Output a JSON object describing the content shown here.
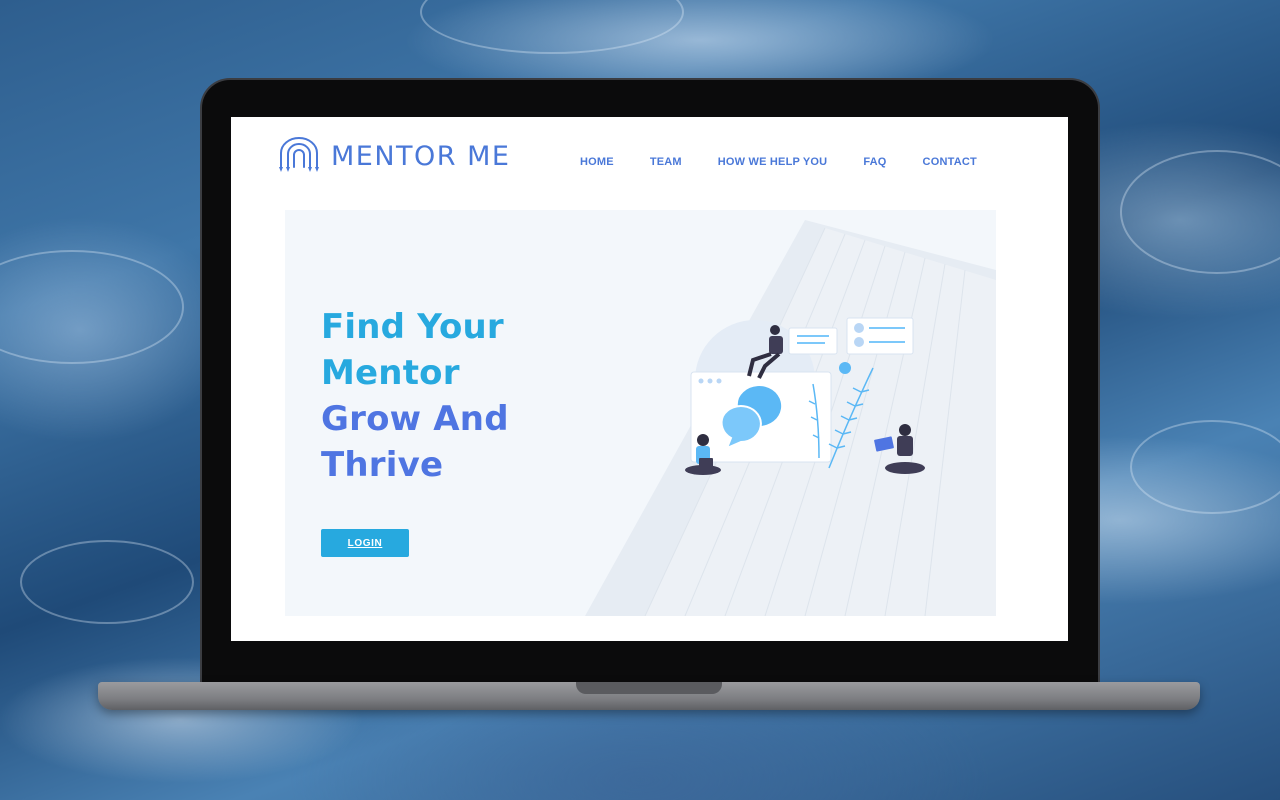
{
  "site": {
    "logo_text": "MENTOR ME",
    "logo_icon": "arch-pencils-icon"
  },
  "nav": {
    "items": [
      {
        "label": "HOME"
      },
      {
        "label": "TEAM"
      },
      {
        "label": "HOW WE HELP YOU"
      },
      {
        "label": "FAQ"
      },
      {
        "label": "CONTACT"
      }
    ]
  },
  "hero": {
    "title_lines": [
      "Find Your",
      "Mentor",
      "Grow And",
      "Thrive"
    ],
    "login_label": "LOGIN",
    "illustration": "mentoring-chat-people-illustration"
  },
  "colors": {
    "brand_blue": "#4a78d8",
    "cyan": "#27a9df",
    "title_blue": "#4f75e2",
    "hero_bg": "#f3f7fb"
  }
}
